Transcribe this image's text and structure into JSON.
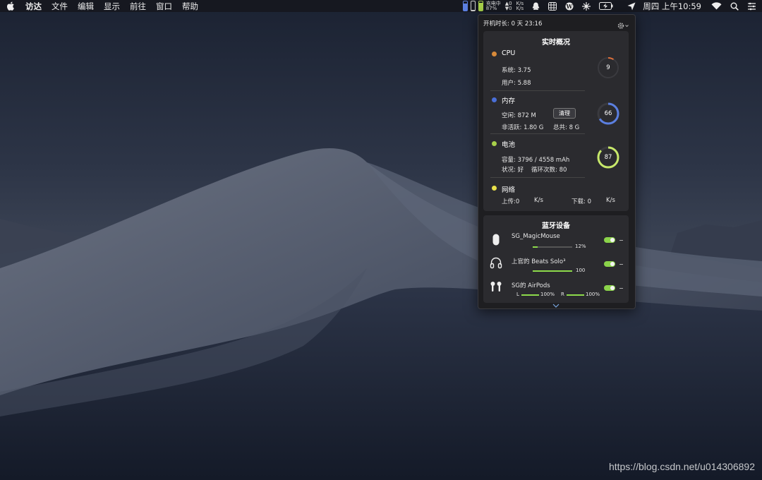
{
  "menubar": {
    "items": [
      "访达",
      "文件",
      "编辑",
      "显示",
      "前往",
      "窗口",
      "帮助"
    ],
    "status": {
      "power_text": "充电中",
      "power_pct": "87%",
      "net_up_arrow": "▲0",
      "net_down_arrow": "▼0",
      "net_up_unit": "K/s",
      "net_down_unit": "K/s",
      "clock": "周四 上午10:59"
    }
  },
  "panel": {
    "uptime": "开机时长: 0 天 23:16",
    "overview_title": "实时概况",
    "cpu": {
      "title": "CPU",
      "system": "系统: 3.75",
      "user": "用户: 5.88",
      "gauge": "9",
      "level": 0.09,
      "color": "#e0703a"
    },
    "memory": {
      "title": "内存",
      "free": "空闲: 872  M",
      "inactive": "非活跃: 1.80   G",
      "total": "总共: 8 G",
      "clean_label": "清理",
      "gauge": "66",
      "level": 0.66,
      "color": "#5b7fe0"
    },
    "battery": {
      "title": "电池",
      "capacity": "容量: 3796 / 4558 mAh",
      "status": "状况: 好",
      "cycles": "循环次数: 80",
      "gauge": "87",
      "level": 0.87,
      "color": "#c7e86a"
    },
    "network": {
      "title": "网络",
      "upload": "上传:0",
      "upload_unit": "K/s",
      "download": "下载: 0",
      "download_unit": "K/s"
    },
    "dot_colors": {
      "cpu": "#d88a3a",
      "memory": "#4a6fd8",
      "battery": "#a8d04a",
      "network": "#e8e04a"
    },
    "bluetooth": {
      "title": "蓝牙设备",
      "devices": [
        {
          "name": "SG_MagicMouse",
          "value": "12%",
          "level": 0.12,
          "icon": "mouse-icon"
        },
        {
          "name": "上官的 Beats Solo³",
          "value": "100",
          "level": 1.0,
          "icon": "headphones-icon"
        },
        {
          "name": "SG的 AirPods",
          "left_label": "L",
          "left_value": "100%",
          "left_level": 1.0,
          "right_label": "R",
          "right_value": "100%",
          "right_level": 1.0,
          "icon": "airpods-icon"
        }
      ]
    }
  },
  "watermark": "https://blog.csdn.net/u014306892"
}
